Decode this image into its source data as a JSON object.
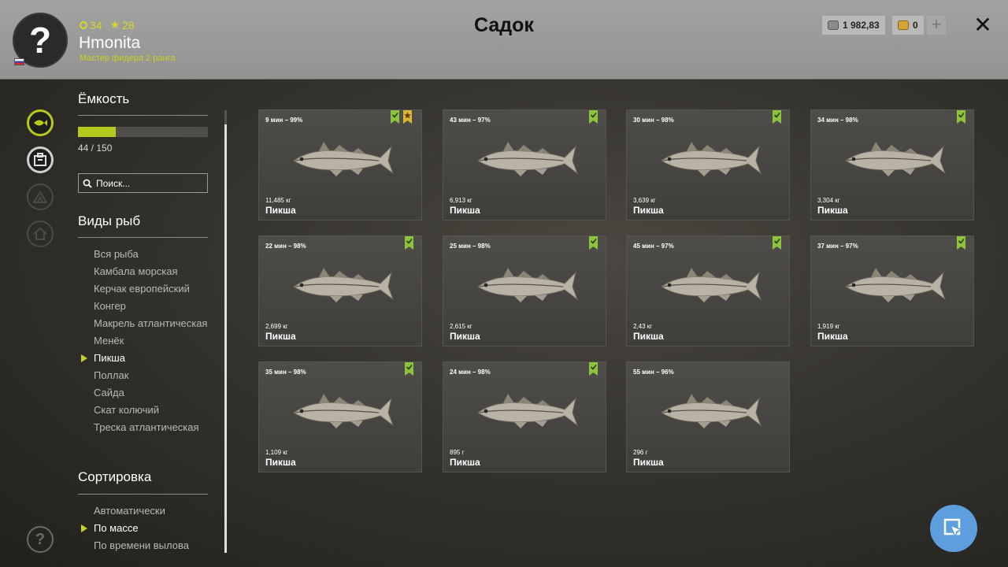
{
  "header": {
    "title": "Садок",
    "player": {
      "avatar_symbol": "?",
      "level": "34",
      "stars": "28",
      "name": "Hmonita",
      "rank": "Мастер фидера 2 ранга"
    },
    "currency": {
      "silver": "1 982,83",
      "gold": "0"
    },
    "plus_label": "+",
    "close_label": "✕"
  },
  "capacity": {
    "heading": "Ёмкость",
    "current": 44,
    "max": 150,
    "fill_fraction": 0.293,
    "text": "44 / 150"
  },
  "search": {
    "placeholder": "Поиск..."
  },
  "species": {
    "heading": "Виды рыб",
    "items": [
      {
        "label": "Вся рыба",
        "active": false
      },
      {
        "label": "Камбала морская",
        "active": false
      },
      {
        "label": "Керчак европейский",
        "active": false
      },
      {
        "label": "Конгер",
        "active": false
      },
      {
        "label": "Макрель атлантическая",
        "active": false
      },
      {
        "label": "Менёк",
        "active": false
      },
      {
        "label": "Пикша",
        "active": true
      },
      {
        "label": "Поллак",
        "active": false
      },
      {
        "label": "Сайда",
        "active": false
      },
      {
        "label": "Скат колючий",
        "active": false
      },
      {
        "label": "Треска атлантическая",
        "active": false
      }
    ]
  },
  "sorting": {
    "heading": "Сортировка",
    "items": [
      {
        "label": "Автоматически",
        "active": false
      },
      {
        "label": "По массе",
        "active": true
      },
      {
        "label": "По времени вылова",
        "active": false
      }
    ]
  },
  "help_label": "?",
  "colors": {
    "accent": "#b5c91e",
    "badge_check": "#8cc43d",
    "badge_star": "#e0b531",
    "button_blue": "#5c9ede"
  },
  "fish": [
    {
      "meta": "9 мин – 99%",
      "weight": "11,485 кг",
      "name": "Пикша",
      "badges": [
        "check",
        "star"
      ]
    },
    {
      "meta": "43 мин – 97%",
      "weight": "6,913 кг",
      "name": "Пикша",
      "badges": [
        "check"
      ]
    },
    {
      "meta": "30 мин – 98%",
      "weight": "3,639 кг",
      "name": "Пикша",
      "badges": [
        "check"
      ]
    },
    {
      "meta": "34 мин – 98%",
      "weight": "3,304 кг",
      "name": "Пикша",
      "badges": [
        "check"
      ]
    },
    {
      "meta": "22 мин – 98%",
      "weight": "2,699 кг",
      "name": "Пикша",
      "badges": [
        "check"
      ]
    },
    {
      "meta": "25 мин – 98%",
      "weight": "2,615 кг",
      "name": "Пикша",
      "badges": [
        "check"
      ]
    },
    {
      "meta": "45 мин – 97%",
      "weight": "2,43 кг",
      "name": "Пикша",
      "badges": [
        "check"
      ]
    },
    {
      "meta": "37 мин – 97%",
      "weight": "1,919 кг",
      "name": "Пикша",
      "badges": [
        "check"
      ]
    },
    {
      "meta": "35 мин – 98%",
      "weight": "1,109 кг",
      "name": "Пикша",
      "badges": [
        "check"
      ]
    },
    {
      "meta": "24 мин – 98%",
      "weight": "895 г",
      "name": "Пикша",
      "badges": [
        "check"
      ]
    },
    {
      "meta": "55 мин – 96%",
      "weight": "296 г",
      "name": "Пикша",
      "badges": []
    }
  ]
}
